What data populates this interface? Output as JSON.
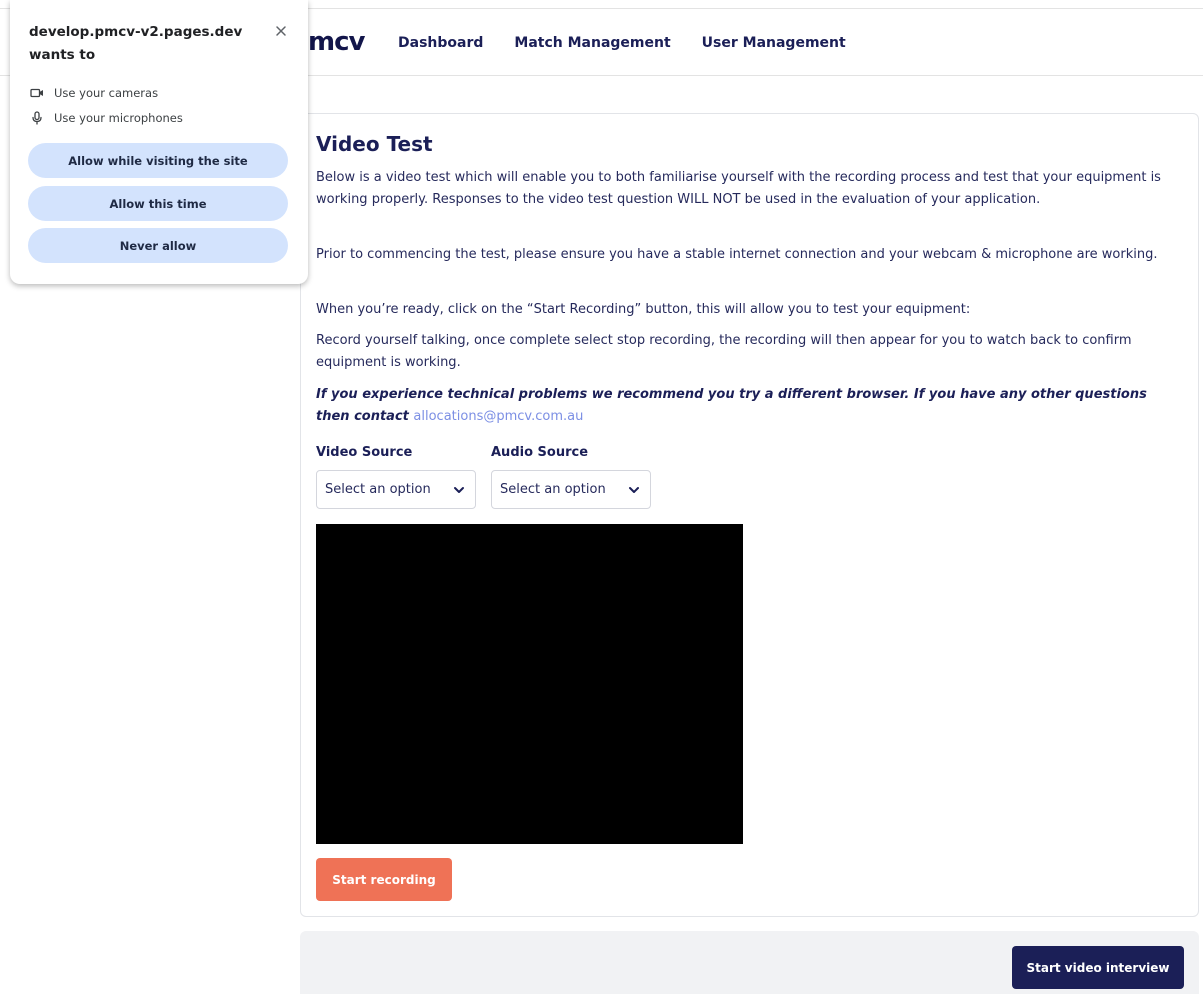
{
  "header": {
    "logo_text": "mcv",
    "nav": [
      "Dashboard",
      "Match Management",
      "User Management"
    ]
  },
  "permission_popup": {
    "site": "develop.pmcv-v2.pages.dev",
    "wants_to": "wants to",
    "permissions": [
      {
        "icon": "camera-icon",
        "label": "Use your cameras"
      },
      {
        "icon": "microphone-icon",
        "label": "Use your microphones"
      }
    ],
    "buttons": {
      "allow_while_visiting": "Allow while visiting the site",
      "allow_this_time": "Allow this time",
      "never_allow": "Never allow"
    }
  },
  "main": {
    "title": "Video Test",
    "paragraphs": [
      "Below is a video test which will enable you to both familiarise yourself with the recording process and test that your equipment is working properly. Responses to the video test question WILL NOT be used in the evaluation of your application.",
      "Prior to commencing the test, please ensure you have a stable internet connection and your webcam & microphone are working.",
      "When you’re ready, click on the “Start Recording” button, this will allow you to test your equipment:",
      "Record yourself talking, once complete select stop recording, the recording will then appear for you to watch back to confirm equipment is working."
    ],
    "notice_text": "If you experience technical problems we recommend you try a different browser. If you have any other questions then contact",
    "contact_email": "allocations@pmcv.com.au",
    "video_source_label": "Video Source",
    "audio_source_label": "Audio Source",
    "video_source_value": "Select an option",
    "audio_source_value": "Select an option",
    "start_recording_label": "Start recording"
  },
  "footer": {
    "start_interview_label": "Start video interview"
  },
  "colors": {
    "navy": "#1b1f57",
    "record_button": "#ef7256",
    "popup_button": "#d3e3fd",
    "link": "#7c8fe4",
    "video_background": "#000000"
  }
}
